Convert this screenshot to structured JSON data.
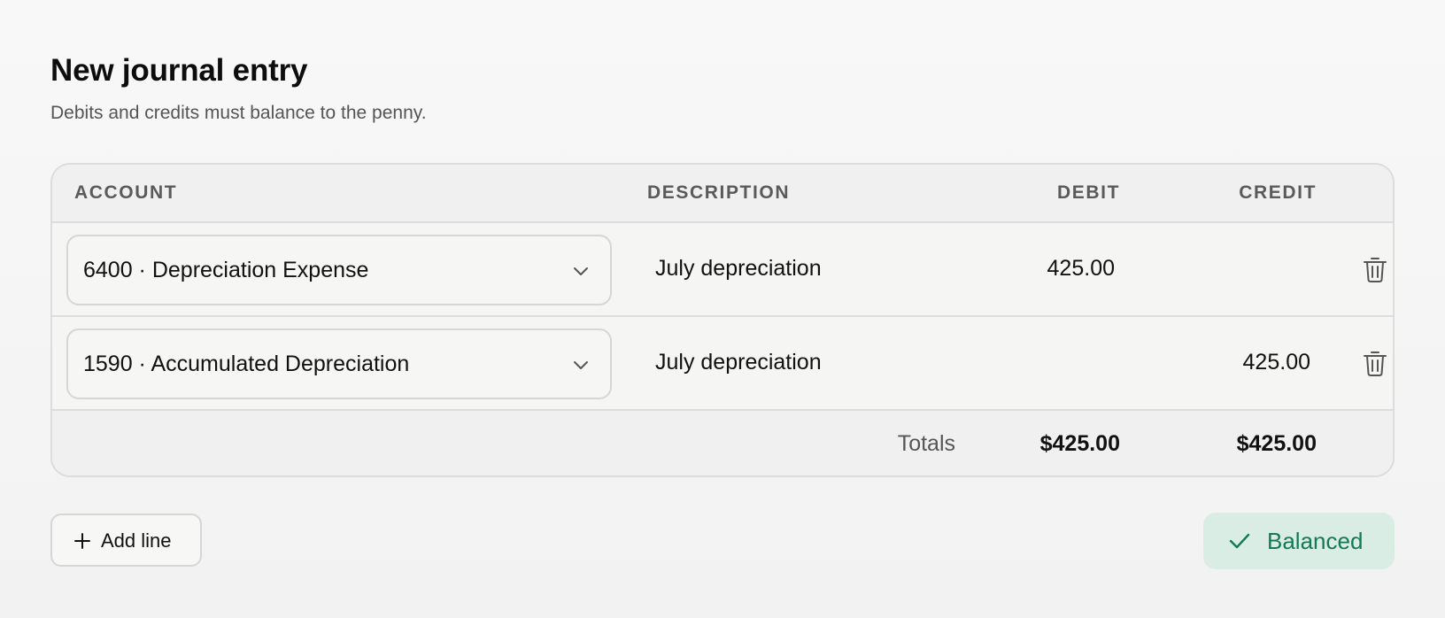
{
  "header": {
    "title": "New journal entry",
    "subtitle": "Debits and credits must balance to the penny."
  },
  "table": {
    "columns": {
      "account": "ACCOUNT",
      "description": "DESCRIPTION",
      "debit": "DEBIT",
      "credit": "CREDIT"
    },
    "rows": [
      {
        "account": "6400 · Depreciation Expense",
        "description": "July depreciation",
        "debit": "425.00",
        "credit": ""
      },
      {
        "account": "1590 · Accumulated Depreciation",
        "description": "July depreciation",
        "debit": "",
        "credit": "425.00"
      }
    ],
    "totals": {
      "label": "Totals",
      "debit": "$425.00",
      "credit": "$425.00"
    }
  },
  "actions": {
    "add_line_label": "Add line"
  },
  "status": {
    "label": "Balanced",
    "color": "#157a53",
    "background": "#d9ede4"
  },
  "icons": {
    "account_dropdown": "chevron-down-icon",
    "row_delete": "trash-icon",
    "add_line": "plus-icon",
    "status": "check-icon"
  }
}
